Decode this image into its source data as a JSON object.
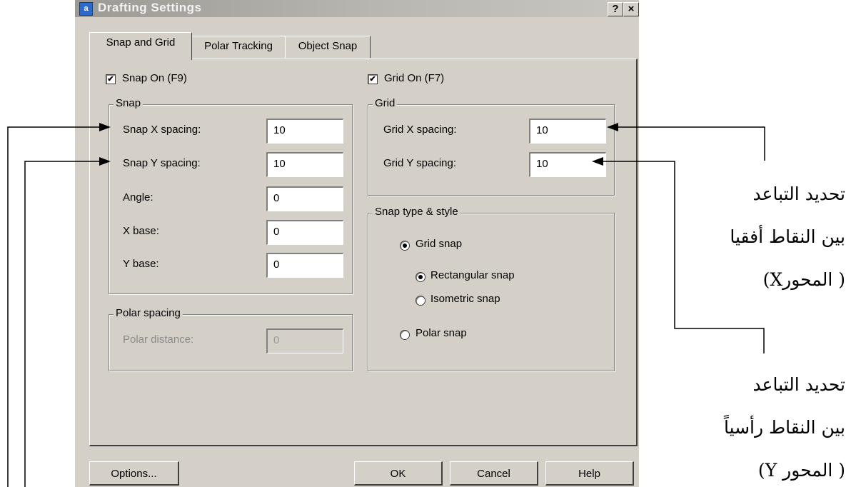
{
  "dialog": {
    "title": "Drafting Settings",
    "help_btn": "?",
    "close_btn": "×",
    "tabs": [
      "Snap and Grid",
      "Polar Tracking",
      "Object Snap"
    ]
  },
  "snap_on": {
    "label": "Snap On (F9)",
    "checked": true
  },
  "grid_on": {
    "label": "Grid On (F7)",
    "checked": true
  },
  "snap": {
    "legend": "Snap",
    "x_label": "Snap X spacing:",
    "x_value": "10",
    "y_label": "Snap Y spacing:",
    "y_value": "10",
    "angle_label": "Angle:",
    "angle_value": "0",
    "xbase_label": "X base:",
    "xbase_value": "0",
    "ybase_label": "Y base:",
    "ybase_value": "0"
  },
  "grid": {
    "legend": "Grid",
    "x_label": "Grid X spacing:",
    "x_value": "10",
    "y_label": "Grid Y spacing:",
    "y_value": "10"
  },
  "polar": {
    "legend": "Polar spacing",
    "distance_label": "Polar distance:",
    "distance_value": "0"
  },
  "snap_type": {
    "legend": "Snap type & style",
    "grid_snap": "Grid snap",
    "rectangular": "Rectangular snap",
    "isometric": "Isometric snap",
    "polar_snap": "Polar snap",
    "selected_type": "Grid snap",
    "selected_style": "Rectangular snap"
  },
  "buttons": {
    "options": "Options...",
    "ok": "OK",
    "cancel": "Cancel",
    "help": "Help"
  },
  "annotations": {
    "x_line1": "تحديد التباعد",
    "x_line2": "بين النقاط أفقيا",
    "x_line3": "( المحورX)",
    "y_line1": "تحديد التباعد",
    "y_line2": "بين النقاط رأسياً",
    "y_line3": "( المحور Y)"
  }
}
